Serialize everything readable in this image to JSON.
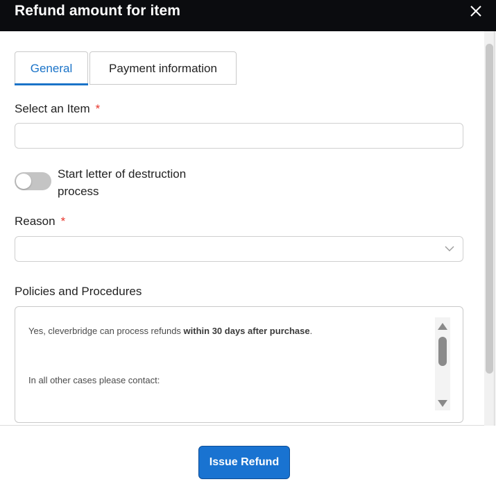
{
  "dialog": {
    "title": "Refund amount for item"
  },
  "tabs": [
    {
      "label": "General",
      "active": true
    },
    {
      "label": "Payment information",
      "active": false
    }
  ],
  "form": {
    "select_item": {
      "label": "Select an Item",
      "required_mark": "*",
      "value": ""
    },
    "toggle": {
      "label": "Start letter of destruction process",
      "on": false
    },
    "reason": {
      "label": "Reason",
      "required_mark": "*",
      "value": ""
    },
    "policies": {
      "label": "Policies and Procedures",
      "line1_prefix": "Yes, cleverbridge can process refunds ",
      "line1_bold": "within 30 days after purchase",
      "line1_suffix": ".",
      "line2": "In all other cases please contact:"
    }
  },
  "footer": {
    "issue_refund_label": "Issue Refund"
  },
  "icons": {
    "close": "close-icon",
    "reason_dropdown": "chevron-down-icon"
  },
  "colors": {
    "header_bg": "#0b0c0f",
    "accent": "#1a73c8",
    "button": "#1973d1",
    "required": "#e8342a"
  }
}
